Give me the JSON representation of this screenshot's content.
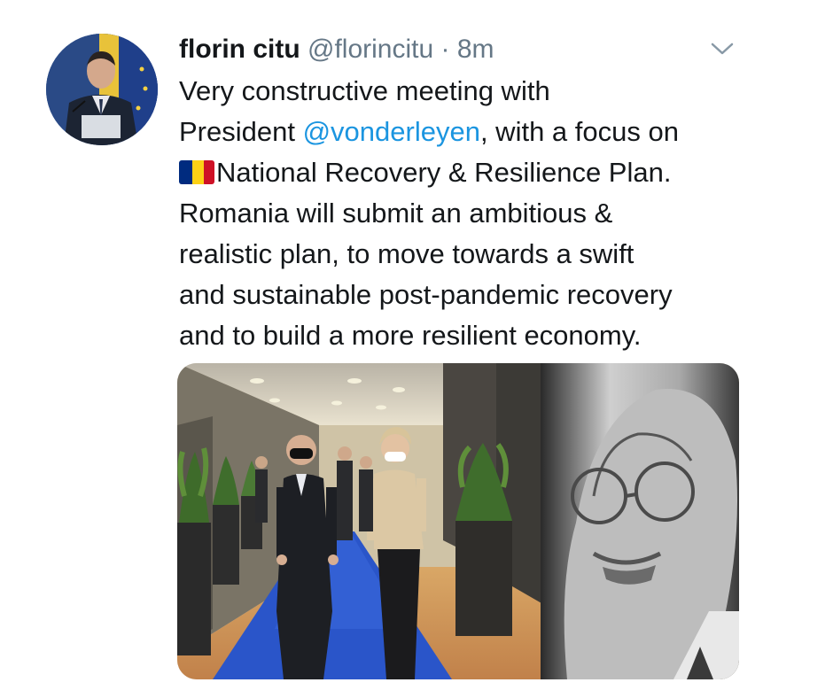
{
  "tweet": {
    "author_name": "florin citu",
    "author_handle": "@florincitu",
    "separator": "·",
    "timestamp": "8m",
    "text": {
      "line1": "Very constructive meeting with",
      "line2_prefix": "President ",
      "line2_mention": "@vonderleyen",
      "line2_suffix": ", with a focus on",
      "line3_flag_icon": "romania-flag-emoji",
      "line3_text": "National Recovery & Resilience Plan.",
      "line4": "Romania will submit an ambitious &",
      "line5": "realistic plan, to move towards a swift",
      "line6": "and sustainable post-pandemic recovery",
      "line7": "and to build a more resilient economy."
    }
  },
  "colors": {
    "text": "#14171a",
    "secondary": "#657786",
    "link": "#1b95e0",
    "flag_blue": "#002b7f",
    "flag_yellow": "#fcd116",
    "flag_red": "#ce1126"
  }
}
